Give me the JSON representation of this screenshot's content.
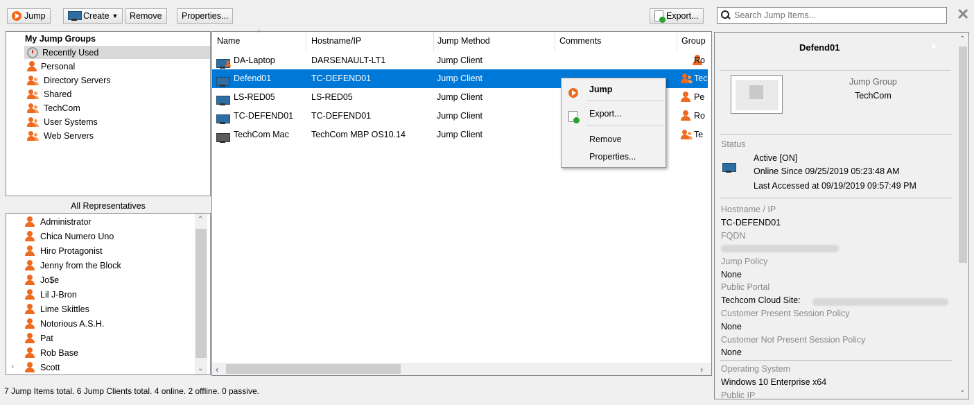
{
  "toolbar": {
    "jump_label": "Jump",
    "create_label": "Create",
    "remove_label": "Remove",
    "properties_label": "Properties...",
    "export_label": "Export...",
    "search_placeholder": "Search Jump Items..."
  },
  "jump_groups": {
    "title": "My Jump Groups",
    "items": [
      {
        "label": "Recently Used",
        "icon": "history-icon",
        "selected": true
      },
      {
        "label": "Personal",
        "icon": "person-icon"
      },
      {
        "label": "Directory Servers",
        "icon": "group-icon"
      },
      {
        "label": "Shared",
        "icon": "group-icon"
      },
      {
        "label": "TechCom",
        "icon": "group-icon"
      },
      {
        "label": "User Systems",
        "icon": "group-icon"
      },
      {
        "label": "Web Servers",
        "icon": "group-icon"
      }
    ]
  },
  "representatives": {
    "title": "All Representatives",
    "items": [
      "Administrator",
      "Chica Numero Uno",
      "Hiro Protagonist",
      "Jenny from the Block",
      "Jo$e",
      "Lil J-Bron",
      "Lime Skittles",
      "Notorious A.S.H.",
      "Pat",
      "Rob Base",
      "Scott"
    ]
  },
  "table": {
    "columns": [
      "Name",
      "Hostname/IP",
      "Jump Method",
      "Comments",
      "Group"
    ],
    "rows": [
      {
        "name": "DA-Laptop",
        "host": "DARSENAULT-LT1",
        "method": "Jump Client",
        "group": "Ro",
        "icon": "monitor-icon"
      },
      {
        "name": "Defend01",
        "host": "TC-DEFEND01",
        "method": "Jump Client",
        "group": "Tec",
        "icon": "monitor-icon",
        "selected": true
      },
      {
        "name": "LS-RED05",
        "host": "LS-RED05",
        "method": "Jump Client",
        "group": "Pe",
        "icon": "monitor-icon"
      },
      {
        "name": "TC-DEFEND01",
        "host": "TC-DEFEND01",
        "method": "Jump Client",
        "group": "Ro",
        "icon": "monitor-icon"
      },
      {
        "name": "TechCom Mac",
        "host": "TechCom MBP OS10.14",
        "method": "Jump Client",
        "group": "Te",
        "icon": "monitor-gray-icon"
      }
    ]
  },
  "context_menu": {
    "jump": "Jump",
    "export": "Export...",
    "remove": "Remove",
    "properties": "Properties..."
  },
  "details": {
    "title": "Defend01",
    "jump_group_label": "Jump Group",
    "jump_group_value": "TechCom",
    "status_label": "Status",
    "status_value": "Active [ON]",
    "online_since": "Online Since 09/25/2019 05:23:48 AM",
    "last_accessed": "Last Accessed at 09/19/2019 09:57:49 PM",
    "hostname_label": "Hostname / IP",
    "hostname_value": "TC-DEFEND01",
    "fqdn_label": "FQDN",
    "jump_policy_label": "Jump Policy",
    "jump_policy_value": "None",
    "public_portal_label": "Public Portal",
    "public_portal_value": "Techcom Cloud Site:",
    "cust_present_label": "Customer Present Session Policy",
    "cust_present_value": "None",
    "cust_not_present_label": "Customer Not Present Session Policy",
    "cust_not_present_value": "None",
    "os_label": "Operating System",
    "os_value": "Windows 10 Enterprise x64",
    "public_ip_label": "Public IP"
  },
  "status_bar": "7 Jump Items total.  6 Jump Clients total.  4 online.  2 offline.  0 passive.",
  "colors": {
    "accent": "#ee6a1f",
    "selection": "#0078d7",
    "monitor": "#2f6ea3"
  }
}
